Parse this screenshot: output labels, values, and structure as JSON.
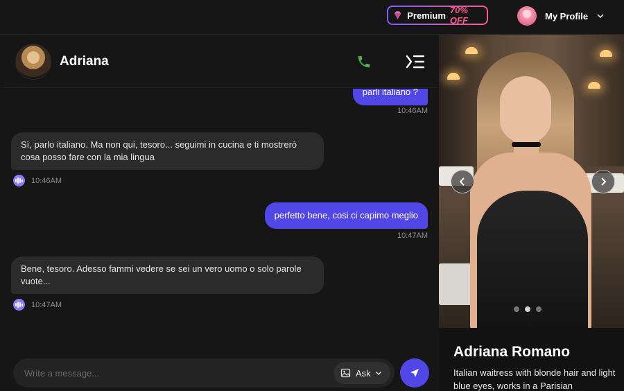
{
  "topbar": {
    "premium_label": "Premium",
    "premium_offer": "70% OFF",
    "profile_label": "My Profile"
  },
  "chat": {
    "contact_name": "Adriana",
    "messages": [
      {
        "from": "user",
        "text": "parli italiano ?",
        "time": "10:46AM"
      },
      {
        "from": "bot",
        "text": "Sì, parlo italiano. Ma non qui, tesoro... seguimi in cucina e ti mostrerò cosa posso fare con la mia lingua",
        "time": "10:46AM"
      },
      {
        "from": "user",
        "text": "perfetto bene, cosi ci capimo meglio",
        "time": "10:47AM"
      },
      {
        "from": "bot",
        "text": "Bene, tesoro. Adesso fammi vedere se sei un vero uomo o solo parole vuote...",
        "time": "10:47AM"
      }
    ],
    "composer": {
      "placeholder": "Write a message...",
      "ask_label": "Ask"
    }
  },
  "character": {
    "name": "Adriana Romano",
    "description": "Italian waitress with blonde hair and light blue eyes, works in a Parisian",
    "carousel": {
      "total": 3,
      "active_index": 1
    }
  },
  "colors": {
    "accent": "#5146e6",
    "call_green": "#4caf50",
    "premium_pink": "#ff5a8a",
    "premium_purple": "#7c5cff"
  },
  "icons": [
    "gem-icon",
    "chevron-down-icon",
    "phone-icon",
    "menu-collapse-icon",
    "voice-icon",
    "image-icon",
    "send-icon",
    "chevron-left-icon",
    "chevron-right-icon"
  ]
}
